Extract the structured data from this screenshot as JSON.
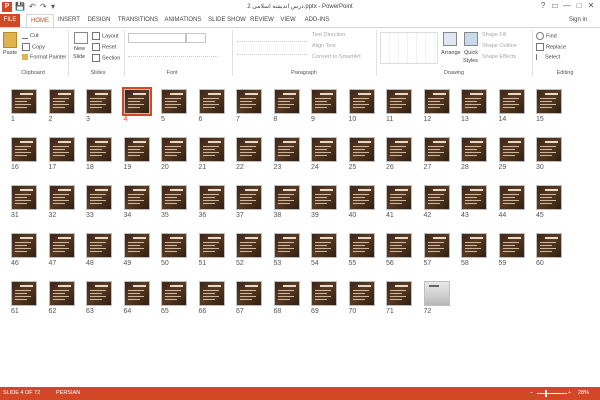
{
  "window": {
    "title": "درس اندیشه اسلامی 2.pptx - PowerPoint",
    "controls": [
      "?",
      "▭",
      "—",
      "□",
      "✕"
    ]
  },
  "quick_access": {
    "save": "💾",
    "undo": "↶",
    "redo": "↷",
    "more": "▾"
  },
  "user": {
    "sign_in": "Sign in"
  },
  "tabs": [
    "FILE",
    "HOME",
    "INSERT",
    "DESIGN",
    "TRANSITIONS",
    "ANIMATIONS",
    "SLIDE SHOW",
    "REVIEW",
    "VIEW",
    "ADD-INS"
  ],
  "ribbon": {
    "clipboard": {
      "paste": "Paste",
      "cut": "Cut",
      "copy": "Copy",
      "format_painter": "Format Painter",
      "label": "Clipboard"
    },
    "slides": {
      "new_slide": "New",
      "new_slide_2": "Slide",
      "layout": "Layout",
      "reset": "Reset",
      "section": "Section",
      "label": "Slides"
    },
    "font": {
      "label": "Font"
    },
    "paragraph": {
      "text_direction": "Text Direction",
      "align_text": "Align Text",
      "convert": "Convert to SmartArt",
      "label": "Paragraph"
    },
    "drawing": {
      "arrange": "Arrange",
      "quick_styles": "Quick",
      "quick_styles_2": "Styles",
      "shape_fill": "Shape Fill",
      "shape_outline": "Shape Outline",
      "shape_effects": "Shape Effects",
      "label": "Drawing"
    },
    "editing": {
      "find": "Find",
      "replace": "Replace",
      "select": "Select",
      "label": "Editing"
    }
  },
  "slides": {
    "count": 72,
    "selected": 4,
    "photo_slide": 72,
    "labels": [
      "1",
      "2",
      "3",
      "4",
      "5",
      "6",
      "7",
      "8",
      "9",
      "10",
      "11",
      "12",
      "13",
      "14",
      "15",
      "16",
      "17",
      "18",
      "19",
      "20",
      "21",
      "22",
      "23",
      "24",
      "25",
      "26",
      "27",
      "28",
      "29",
      "30",
      "31",
      "32",
      "33",
      "34",
      "35",
      "36",
      "37",
      "38",
      "39",
      "40",
      "41",
      "42",
      "43",
      "44",
      "45",
      "46",
      "47",
      "48",
      "49",
      "50",
      "51",
      "52",
      "53",
      "54",
      "55",
      "56",
      "57",
      "58",
      "59",
      "60",
      "61",
      "62",
      "63",
      "64",
      "65",
      "66",
      "67",
      "68",
      "69",
      "70",
      "71",
      "72"
    ]
  },
  "status": {
    "slide_info": "SLIDE 4 OF 72",
    "language": "PERSIAN",
    "zoom": "28%",
    "zoom_minus": "−",
    "zoom_plus": "+"
  },
  "colors": {
    "accent": "#d24726",
    "selected": "#d24726"
  }
}
